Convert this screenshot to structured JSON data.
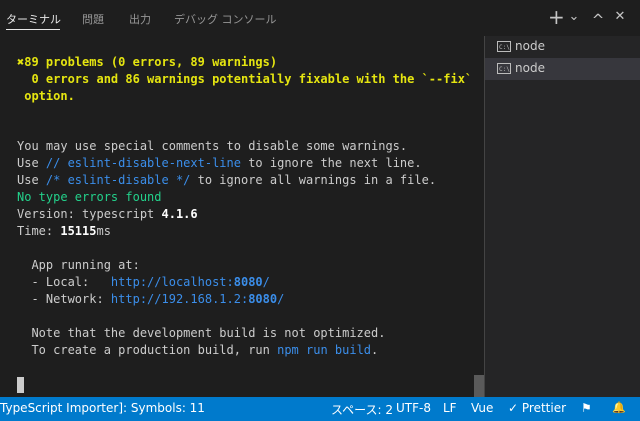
{
  "tabs": [
    {
      "label": "ターミナル",
      "active": true
    },
    {
      "label": "問題",
      "active": false
    },
    {
      "label": "出力",
      "active": false
    },
    {
      "label": "デバッグ コンソール",
      "active": false
    }
  ],
  "toolbar": {
    "plus": "+",
    "chevron": "⌄",
    "up": "^",
    "close": "✕"
  },
  "terminal": {
    "problems": "✖89 problems (0 errors, 89 warnings)",
    "fixable1": "  0 errors and 86 warnings potentially fixable with the `--fix`",
    "fixable2": " option.",
    "comments": "You may use special comments to disable some warnings.",
    "use1_pre": "Use ",
    "use1_code": "// eslint-disable-next-line",
    "use1_post": " to ignore the next line.",
    "use2_pre": "Use ",
    "use2_code": "/* eslint-disable */",
    "use2_post": " to ignore all warnings in a file.",
    "no_type_errors": "No type errors found",
    "version_pre": "Version: typescript ",
    "version_num": "4.1.6",
    "time_pre": "Time: ",
    "time_num": "15115",
    "time_unit": "ms",
    "app_running": "  App running at:",
    "local_pre": "  - Local:   ",
    "local_url_pre": "http://localhost:",
    "local_port": "8080",
    "local_slash": "/",
    "network_pre": "  - Network: ",
    "network_url_pre": "http://192.168.1.2:",
    "network_port": "8080",
    "network_slash": "/",
    "note": "  Note that the development build is not optimized.",
    "create_pre": "  To create a production build, run ",
    "create_cmd": "npm run build",
    "create_post": "."
  },
  "terminal_list": [
    {
      "icon": "C:\\",
      "label": "node",
      "selected": false
    },
    {
      "icon": "C:\\",
      "label": "node",
      "selected": true
    }
  ],
  "statusbar": {
    "left": "TypeScript Importer]: Symbols: 11",
    "spaces": "スペース: 2",
    "encoding": "UTF-8",
    "eol": "LF",
    "language": "Vue",
    "prettier": "✓ Prettier",
    "feedback": "⚑",
    "bell": "🔔"
  }
}
